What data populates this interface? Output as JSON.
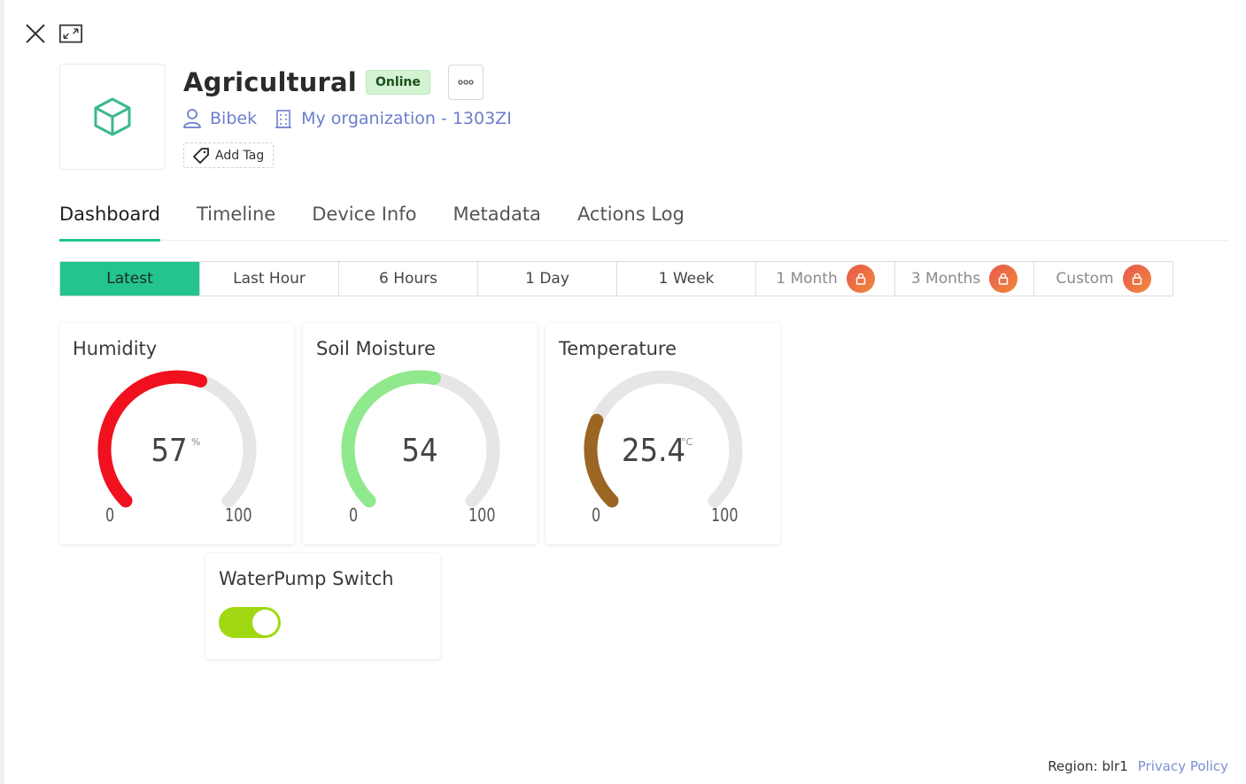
{
  "device": {
    "name": "Agricultural",
    "status": "Online",
    "owner": "Bibek",
    "organization": "My organization - 1303ZI",
    "add_tag_label": "Add Tag"
  },
  "tabs": [
    {
      "label": "Dashboard",
      "active": true
    },
    {
      "label": "Timeline"
    },
    {
      "label": "Device Info"
    },
    {
      "label": "Metadata"
    },
    {
      "label": "Actions Log"
    }
  ],
  "time_ranges": [
    {
      "label": "Latest",
      "active": true
    },
    {
      "label": "Last Hour"
    },
    {
      "label": "6 Hours"
    },
    {
      "label": "1 Day"
    },
    {
      "label": "1 Week"
    },
    {
      "label": "1 Month",
      "locked": true
    },
    {
      "label": "3 Months",
      "locked": true
    },
    {
      "label": "Custom",
      "locked": true
    }
  ],
  "widgets": {
    "humidity": {
      "title": "Humidity",
      "value": "57",
      "unit": "%",
      "min": "0",
      "max": "100",
      "fraction": 0.57,
      "color": "#f0101e"
    },
    "soil": {
      "title": "Soil Moisture",
      "value": "54",
      "unit": "",
      "min": "0",
      "max": "100",
      "fraction": 0.54,
      "color": "#90e98c"
    },
    "temperature": {
      "title": "Temperature",
      "value": "25.4",
      "unit": "°C",
      "min": "0",
      "max": "100",
      "fraction": 0.254,
      "color": "#9b6524"
    },
    "pump": {
      "title": "WaterPump Switch",
      "on": true,
      "color": "#a0d911"
    }
  },
  "footer": {
    "region": "Region: blr1",
    "privacy": "Privacy Policy"
  },
  "colors": {
    "accent": "#23c48e",
    "link": "#6b7fcc",
    "online_bg": "#d3f3d3",
    "gauge_track": "#e6e6e6"
  }
}
